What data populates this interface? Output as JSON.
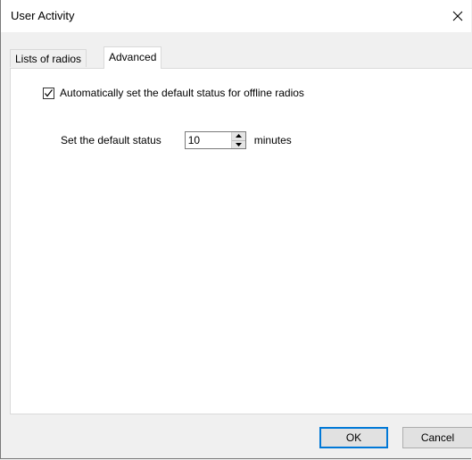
{
  "window": {
    "title": "User Activity",
    "close_label": "×"
  },
  "tabs": [
    {
      "label": "Lists of radios",
      "active": false
    },
    {
      "label": "Advanced",
      "active": true
    }
  ],
  "advanced": {
    "auto_default_label": "Automatically set the default status for offline radios",
    "auto_default_checked": true,
    "default_status_label": "Set the default status",
    "default_status_value": "10",
    "minutes_label": "minutes"
  },
  "buttons": {
    "ok_label": "OK",
    "cancel_label": "Cancel"
  },
  "colors": {
    "accent": "#0078d7",
    "background": "#f0f0f0",
    "panel": "#ffffff"
  },
  "icons": {
    "close": "close-icon",
    "checkmark": "checkmark-icon",
    "spin_up": "spin-up-arrow-icon",
    "spin_down": "spin-down-arrow-icon"
  }
}
